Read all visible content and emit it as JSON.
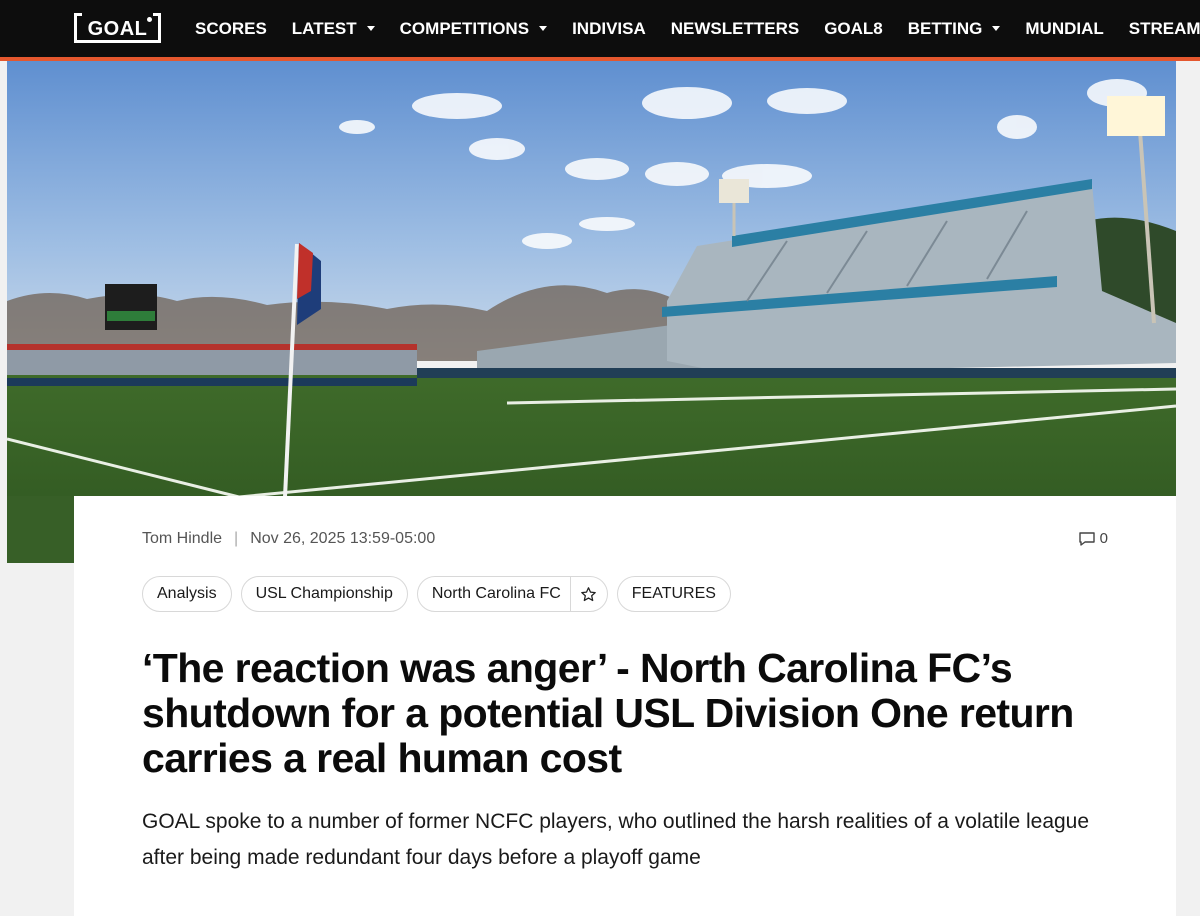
{
  "brand": {
    "logo_text": "GOAL"
  },
  "nav": {
    "items": [
      {
        "label": "SCORES",
        "dropdown": false
      },
      {
        "label": "LATEST",
        "dropdown": true
      },
      {
        "label": "COMPETITIONS",
        "dropdown": true
      },
      {
        "label": "INDIVISA",
        "dropdown": false
      },
      {
        "label": "NEWSLETTERS",
        "dropdown": false
      },
      {
        "label": "GOAL8",
        "dropdown": false
      },
      {
        "label": "BETTING",
        "dropdown": true
      },
      {
        "label": "MUNDIAL",
        "dropdown": false
      },
      {
        "label": "STREAM",
        "dropdown": false
      }
    ]
  },
  "colors": {
    "nav_bg": "#0d0d0d",
    "accent": "#e4572e",
    "card_bg": "#ffffff"
  },
  "article": {
    "author": "Tom Hindle",
    "timestamp": "Nov 26, 2025 13:59-05:00",
    "comment_count": "0",
    "tags": [
      "Analysis",
      "USL Championship",
      "North Carolina FC",
      "FEATURES"
    ],
    "favorite_icon": "star-icon",
    "headline": "‘The reaction was anger’ - North Carolina FC’s shutdown for a potential USL Division One return carries a real human cost",
    "standfirst": "GOAL spoke to a number of former NCFC players, who outlined the harsh realities of a volatile league after being made redundant four days before a playoff game"
  }
}
